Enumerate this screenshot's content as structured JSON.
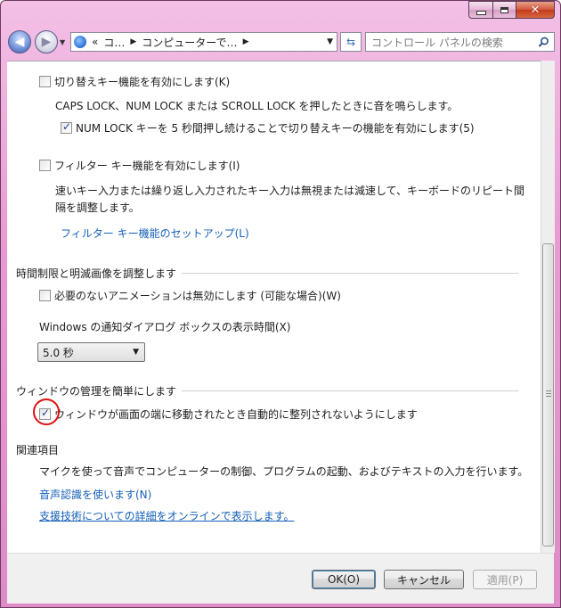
{
  "window": {
    "caption": {
      "minimize": "minimize",
      "maximize": "maximize",
      "close": "close"
    }
  },
  "nav": {
    "address_segments": [
      "«",
      "コ…",
      "コンピューターで…"
    ],
    "search_placeholder": "コントロール パネルの検索"
  },
  "toggle_keys": {
    "checkbox_label": "切り替えキー機能を有効にします(K)",
    "checked": false,
    "description": "CAPS LOCK、NUM LOCK または SCROLL LOCK を押したときに音を鳴らします。",
    "sub_checkbox_label": "NUM LOCK キーを 5 秒間押し続けることで切り替えキーの機能を有効にします(5)",
    "sub_checked": true
  },
  "filter_keys": {
    "checkbox_label": "フィルター キー機能を有効にします(I)",
    "checked": false,
    "description_line1": "速いキー入力または繰り返し入力されたキー入力は無視または減速して、キーボードのリピート間",
    "description_line2": "隔を調整します。",
    "setup_link": "フィルター キー機能のセットアップ(L)"
  },
  "time_limits": {
    "heading": "時間制限と明滅画像を調整します",
    "animations_label": "必要のないアニメーションは無効にします (可能な場合)(W)",
    "animations_checked": false,
    "notification_label": "Windows の通知ダイアログ ボックスの表示時間(X)",
    "notification_value": "5.0 秒"
  },
  "window_mgmt": {
    "heading": "ウィンドウの管理を簡単にします",
    "snap_label": "ウィンドウが画面の端に移動されたとき自動的に整列されないようにします",
    "snap_checked": true
  },
  "related": {
    "heading": "関連項目",
    "speech_desc": "マイクを使って音声でコンピューターの制御、プログラムの起動、およびテキストの入力を行います。",
    "speech_link": "音声認識を使います(N)",
    "online_link": "支援技術についての詳細をオンラインで表示します。"
  },
  "buttons": {
    "ok": "OK(O)",
    "cancel": "キャンセル",
    "apply": "適用(P)"
  }
}
